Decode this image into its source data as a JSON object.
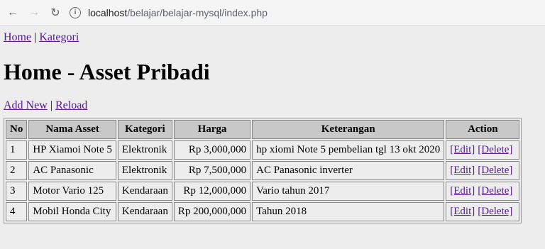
{
  "browser": {
    "url_host": "localhost",
    "url_path": "/belajar/belajar-mysql/index.php"
  },
  "nav": {
    "home": "Home",
    "separator": "|",
    "kategori": "Kategori"
  },
  "page_title": "Home - Asset Pribadi",
  "actions": {
    "add_new": "Add New",
    "separator": "|",
    "reload": "Reload"
  },
  "table": {
    "headers": [
      "No",
      "Nama Asset",
      "Kategori",
      "Harga",
      "Keterangan",
      "Action"
    ],
    "edit_label": "[Edit]",
    "delete_label": "[Delete]",
    "rows": [
      {
        "no": "1",
        "nama": "HP Xiamoi Note 5",
        "kategori": "Elektronik",
        "harga": "Rp 3,000,000",
        "keterangan": "hp xiomi Note 5 pembelian tgl 13 okt 2020"
      },
      {
        "no": "2",
        "nama": "AC Panasonic",
        "kategori": "Elektronik",
        "harga": "Rp 7,500,000",
        "keterangan": "AC Panasonic inverter"
      },
      {
        "no": "3",
        "nama": "Motor Vario 125",
        "kategori": "Kendaraan",
        "harga": "Rp 12,000,000",
        "keterangan": "Vario tahun 2017"
      },
      {
        "no": "4",
        "nama": "Mobil Honda City",
        "kategori": "Kendaraan",
        "harga": "Rp 200,000,000",
        "keterangan": "Tahun 2018"
      }
    ]
  }
}
